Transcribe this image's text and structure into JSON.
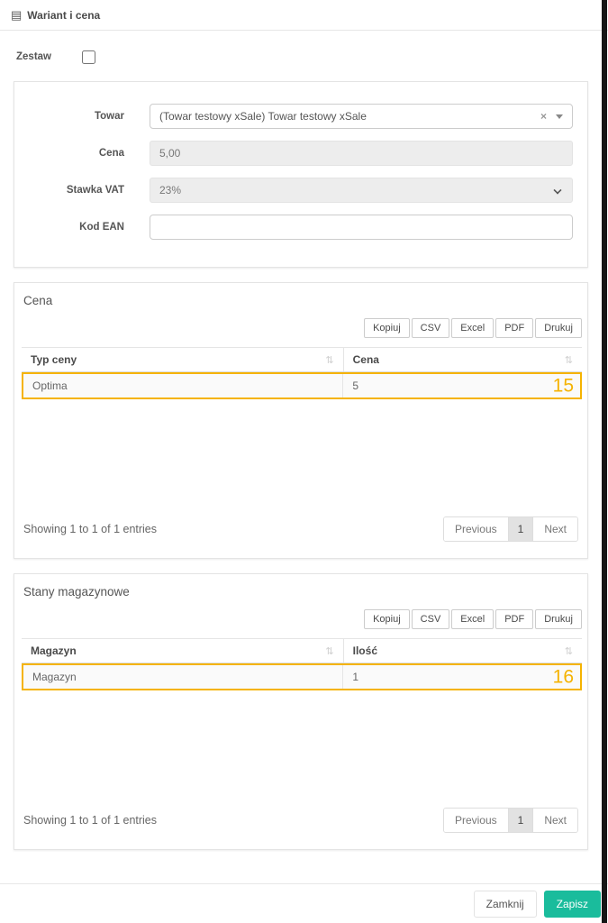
{
  "header": {
    "title": "Wariant i cena"
  },
  "icons": {
    "header_table": "▤",
    "sort": "⇅",
    "clear": "×"
  },
  "zestaw": {
    "label": "Zestaw",
    "checked": false
  },
  "form": {
    "towar": {
      "label": "Towar",
      "value": "(Towar testowy xSale) Towar testowy xSale"
    },
    "cena": {
      "label": "Cena",
      "value": "5,00"
    },
    "stawka_vat": {
      "label": "Stawka VAT",
      "value": "23%"
    },
    "kod_ean": {
      "label": "Kod EAN",
      "value": ""
    }
  },
  "export_buttons": [
    "Kopiuj",
    "CSV",
    "Excel",
    "PDF",
    "Drukuj"
  ],
  "sections": [
    {
      "title": "Cena",
      "columns": [
        "Typ ceny",
        "Cena"
      ],
      "rows": [
        [
          "Optima",
          "5"
        ]
      ],
      "info": "Showing 1 to 1 of 1 entries",
      "annotation": "15"
    },
    {
      "title": "Stany magazynowe",
      "columns": [
        "Magazyn",
        "Ilość"
      ],
      "rows": [
        [
          "Magazyn",
          "1"
        ]
      ],
      "info": "Showing 1 to 1 of 1 entries",
      "annotation": "16"
    }
  ],
  "pagination": {
    "previous": "Previous",
    "page": "1",
    "next": "Next"
  },
  "footer": {
    "close": "Zamknij",
    "save": "Zapisz"
  },
  "colors": {
    "save_button": "#1abc9c",
    "annotation": "#f5b301",
    "disabled_field": "#ededed"
  }
}
